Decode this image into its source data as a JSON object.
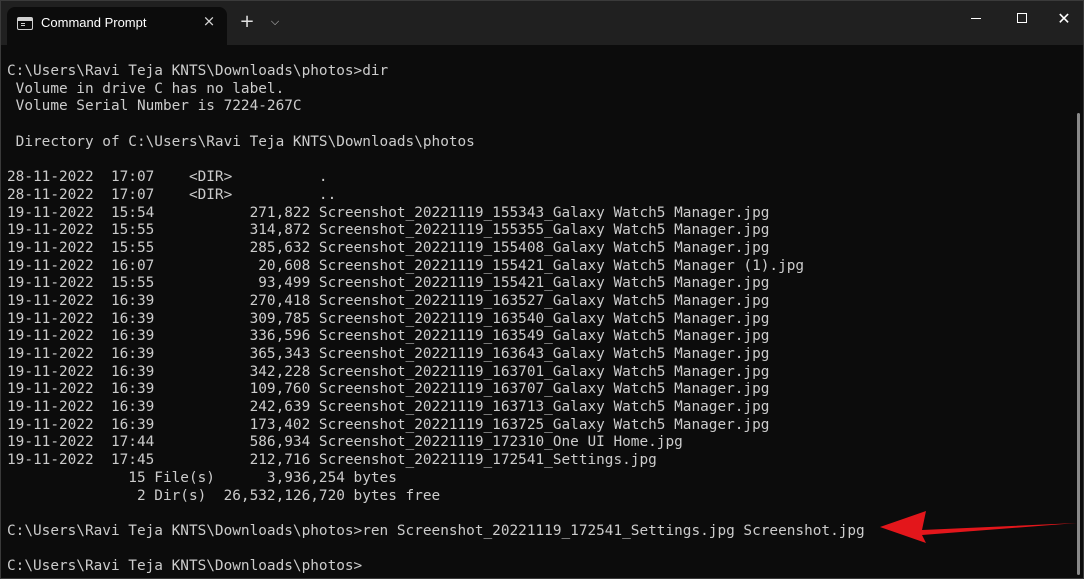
{
  "tab": {
    "title": "Command Prompt",
    "close_icon": "×",
    "new_tab_icon": "+",
    "dropdown_icon": "⌵"
  },
  "window": {
    "close_icon": "✕"
  },
  "terminal": {
    "lines": [
      "C:\\Users\\Ravi Teja KNTS\\Downloads\\photos>dir",
      " Volume in drive C has no label.",
      " Volume Serial Number is 7224-267C",
      "",
      " Directory of C:\\Users\\Ravi Teja KNTS\\Downloads\\photos",
      "",
      "28-11-2022  17:07    <DIR>          .",
      "28-11-2022  17:07    <DIR>          ..",
      "19-11-2022  15:54           271,822 Screenshot_20221119_155343_Galaxy Watch5 Manager.jpg",
      "19-11-2022  15:55           314,872 Screenshot_20221119_155355_Galaxy Watch5 Manager.jpg",
      "19-11-2022  15:55           285,632 Screenshot_20221119_155408_Galaxy Watch5 Manager.jpg",
      "19-11-2022  16:07            20,608 Screenshot_20221119_155421_Galaxy Watch5 Manager (1).jpg",
      "19-11-2022  15:55            93,499 Screenshot_20221119_155421_Galaxy Watch5 Manager.jpg",
      "19-11-2022  16:39           270,418 Screenshot_20221119_163527_Galaxy Watch5 Manager.jpg",
      "19-11-2022  16:39           309,785 Screenshot_20221119_163540_Galaxy Watch5 Manager.jpg",
      "19-11-2022  16:39           336,596 Screenshot_20221119_163549_Galaxy Watch5 Manager.jpg",
      "19-11-2022  16:39           365,343 Screenshot_20221119_163643_Galaxy Watch5 Manager.jpg",
      "19-11-2022  16:39           342,228 Screenshot_20221119_163701_Galaxy Watch5 Manager.jpg",
      "19-11-2022  16:39           109,760 Screenshot_20221119_163707_Galaxy Watch5 Manager.jpg",
      "19-11-2022  16:39           242,639 Screenshot_20221119_163713_Galaxy Watch5 Manager.jpg",
      "19-11-2022  16:39           173,402 Screenshot_20221119_163725_Galaxy Watch5 Manager.jpg",
      "19-11-2022  17:44           586,934 Screenshot_20221119_172310_One UI Home.jpg",
      "19-11-2022  17:45           212,716 Screenshot_20221119_172541_Settings.jpg",
      "              15 File(s)      3,936,254 bytes",
      "               2 Dir(s)  26,532,126,720 bytes free",
      "",
      "C:\\Users\\Ravi Teja KNTS\\Downloads\\photos>ren Screenshot_20221119_172541_Settings.jpg Screenshot.jpg",
      "",
      "C:\\Users\\Ravi Teja KNTS\\Downloads\\photos>"
    ]
  },
  "colors": {
    "background": "#0c0c0c",
    "titlebar": "#202020",
    "text": "#cccccc",
    "annotation_arrow": "#e3161b"
  }
}
